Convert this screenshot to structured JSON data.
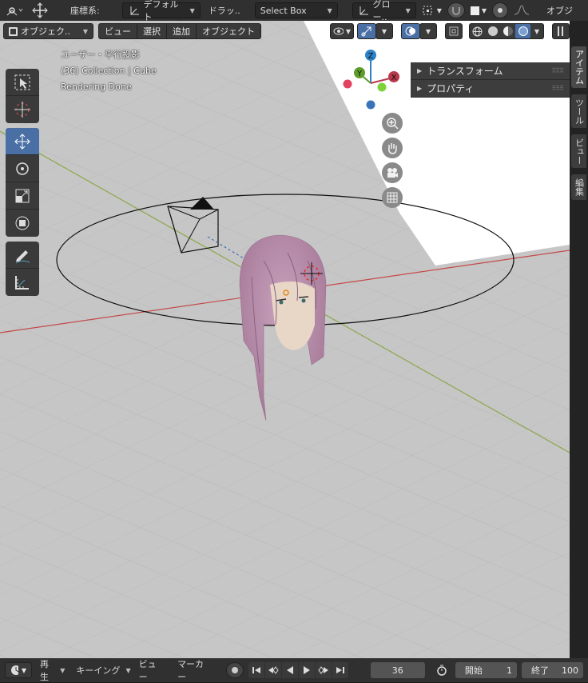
{
  "topbar": {
    "coord_label": "座標系:",
    "coord_value": "デフォルト",
    "drag_label": "ドラッ..",
    "select_mode": "Select Box",
    "transform_orient": "グロー..",
    "overlay_label": "オブジ"
  },
  "viewport_header": {
    "mode": "オブジェク..",
    "menu": [
      "ビュー",
      "選択",
      "追加",
      "オブジェクト"
    ]
  },
  "overlay": {
    "view_name": "ユーザー・平行投影",
    "collection": "(36) Collection | Cube",
    "status": "Rendering Done"
  },
  "gizmo": {
    "x": "X",
    "y": "Y",
    "z": "Z",
    "x_color": "#b8384c",
    "y_color": "#5e9c2a",
    "z_color": "#2c82c9"
  },
  "npanel": {
    "sections": [
      "トランスフォーム",
      "プロパティ"
    ]
  },
  "tabs": [
    "アイテム",
    "ツール",
    "ビュー",
    "編集"
  ],
  "timeline": {
    "playback": "再生",
    "keying": "キーイング",
    "view": "ビュー",
    "marker": "マーカー",
    "current_frame": "36",
    "start_label": "開始",
    "start_value": "1",
    "end_label": "終了",
    "end_value": "100"
  },
  "colors": {
    "accent": "#4a6fa5",
    "x_axis_line": "#c44a4a",
    "y_axis_line": "#8aa84a",
    "hair": "#b48aa8"
  }
}
